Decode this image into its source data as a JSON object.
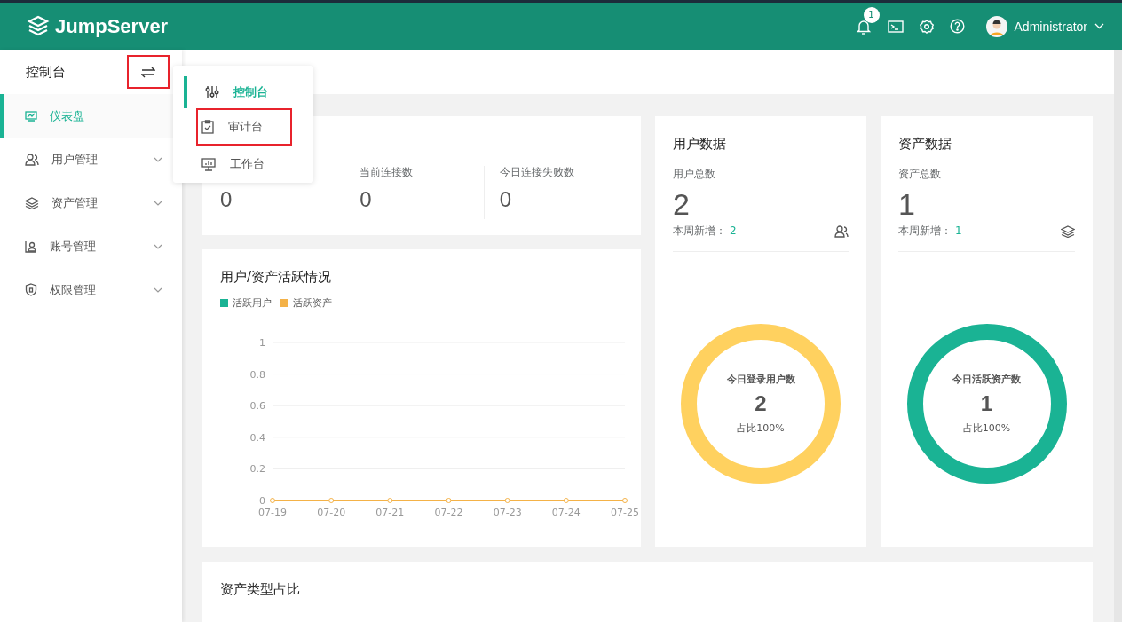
{
  "header": {
    "logo": "JumpServer",
    "notifications": "1",
    "user": "Administrator"
  },
  "sidebar": {
    "title": "控制台",
    "switch_highlighted": true,
    "items": [
      {
        "label": "仪表盘",
        "selected": true,
        "expandable": false
      },
      {
        "label": "用户管理",
        "selected": false,
        "expandable": true
      },
      {
        "label": "资产管理",
        "selected": false,
        "expandable": true
      },
      {
        "label": "账号管理",
        "selected": false,
        "expandable": true
      },
      {
        "label": "权限管理",
        "selected": false,
        "expandable": true
      }
    ]
  },
  "view_menu": [
    {
      "label": "控制台",
      "selected": true,
      "highlighted": false
    },
    {
      "label": "审计台",
      "selected": false,
      "highlighted": true
    },
    {
      "label": "工作台",
      "selected": false,
      "highlighted": false
    }
  ],
  "realtime": {
    "stats": [
      {
        "value": "0"
      },
      {
        "label": "当前连接数",
        "value": "0"
      },
      {
        "label": "今日连接失败数",
        "value": "0"
      }
    ]
  },
  "activity": {
    "title": "用户/资产活跃情况",
    "chart_data": {
      "type": "line",
      "categories": [
        "07-19",
        "07-20",
        "07-21",
        "07-22",
        "07-23",
        "07-24",
        "07-25"
      ],
      "ylim": [
        0,
        1
      ],
      "yticks": [
        0,
        0.2,
        0.4,
        0.6,
        0.8,
        1
      ],
      "grid": true,
      "series": [
        {
          "name": "活跃用户",
          "color": "#1ab394",
          "values": [
            null,
            null,
            null,
            null,
            null,
            null,
            null
          ]
        },
        {
          "name": "活跃资产",
          "color": "#f4b248",
          "marker": true,
          "values": [
            0,
            0,
            0,
            0,
            0,
            0,
            0
          ]
        }
      ]
    }
  },
  "summary_cards": [
    {
      "title": "用户数据",
      "total_label": "用户总数",
      "total": "2",
      "weekly_label": "本周新增：",
      "weekly": "2",
      "ring_title": "今日登录用户数",
      "ring_value": "2",
      "ring_ratio": "占比100%",
      "color": "#ffd15f"
    },
    {
      "title": "资产数据",
      "total_label": "资产总数",
      "total": "1",
      "weekly_label": "本周新增：",
      "weekly": "1",
      "ring_title": "今日活跃资产数",
      "ring_value": "1",
      "ring_ratio": "占比100%",
      "color": "#1ab394"
    }
  ],
  "asset_types": {
    "title": "资产类型占比"
  }
}
